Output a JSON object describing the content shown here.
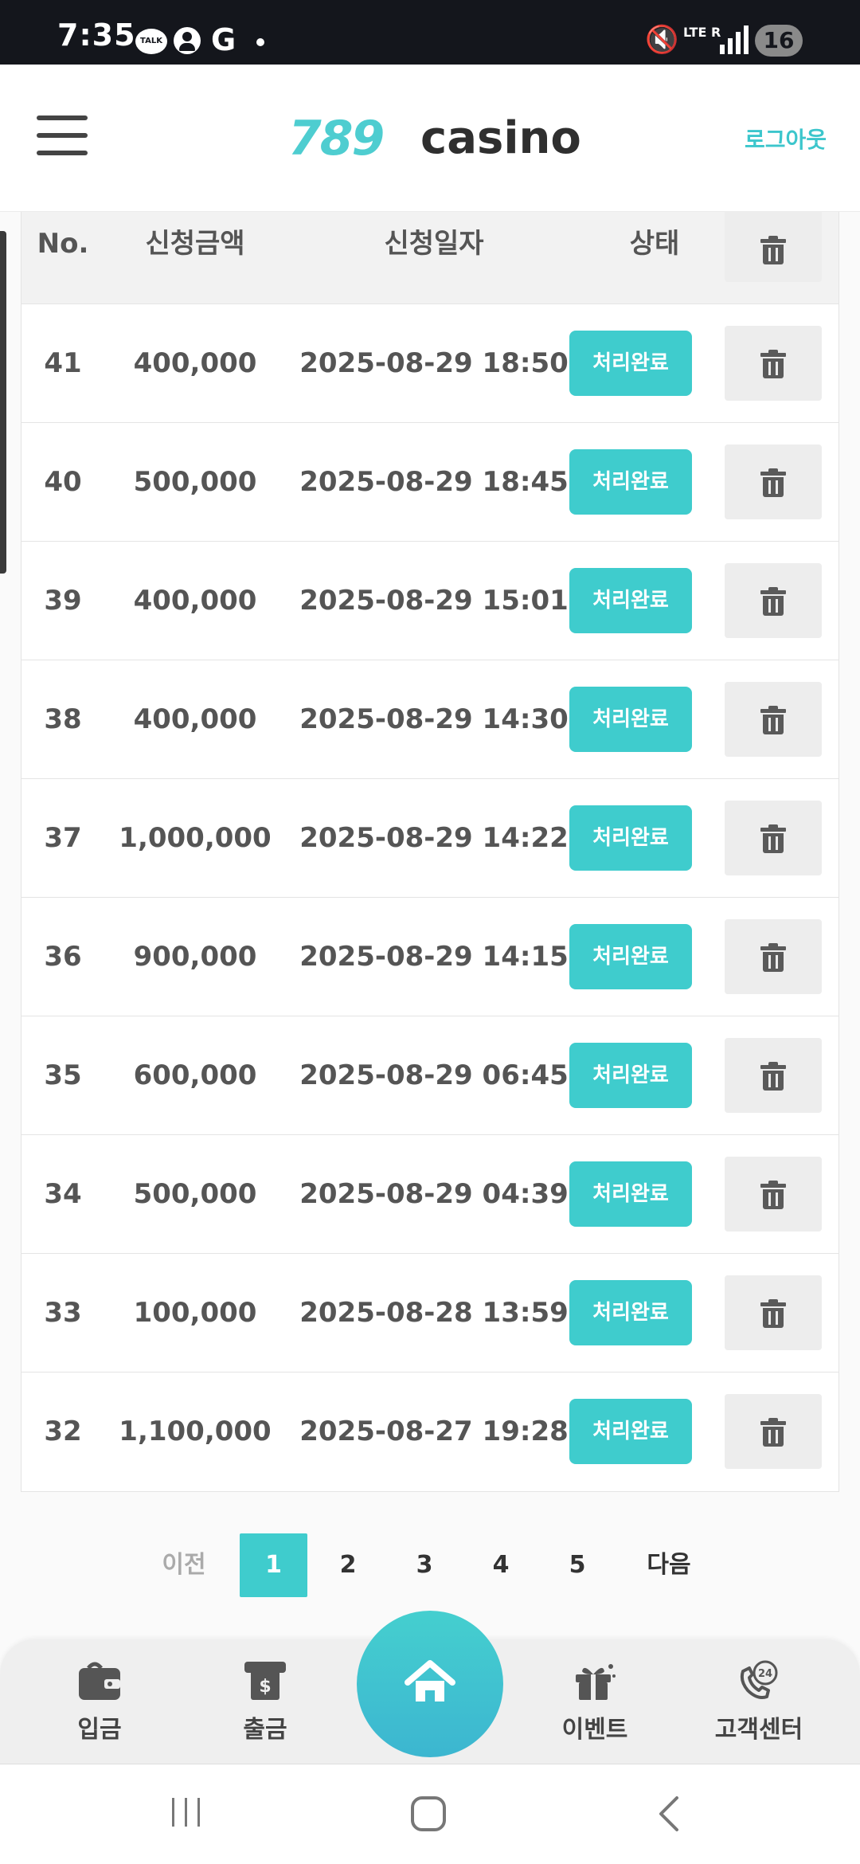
{
  "status_bar": {
    "time": "7:35",
    "talk_label": "TALK",
    "g_label": "G",
    "network_label": "LTE R",
    "battery": "16"
  },
  "header": {
    "logo_number": "789",
    "logo_word": "casino",
    "logout_label": "로그아웃"
  },
  "table": {
    "headers": [
      "No.",
      "신청금액",
      "신청일자",
      "상태"
    ],
    "rows": [
      {
        "no": "41",
        "amount": "400,000",
        "date": "2025-08-29 18:50",
        "status": "처리완료"
      },
      {
        "no": "40",
        "amount": "500,000",
        "date": "2025-08-29 18:45",
        "status": "처리완료"
      },
      {
        "no": "39",
        "amount": "400,000",
        "date": "2025-08-29 15:01",
        "status": "처리완료"
      },
      {
        "no": "38",
        "amount": "400,000",
        "date": "2025-08-29 14:30",
        "status": "처리완료"
      },
      {
        "no": "37",
        "amount": "1,000,000",
        "date": "2025-08-29 14:22",
        "status": "처리완료"
      },
      {
        "no": "36",
        "amount": "900,000",
        "date": "2025-08-29 14:15",
        "status": "처리완료"
      },
      {
        "no": "35",
        "amount": "600,000",
        "date": "2025-08-29 06:45",
        "status": "처리완료"
      },
      {
        "no": "34",
        "amount": "500,000",
        "date": "2025-08-29 04:39",
        "status": "처리완료"
      },
      {
        "no": "33",
        "amount": "100,000",
        "date": "2025-08-28 13:59",
        "status": "처리완료"
      },
      {
        "no": "32",
        "amount": "1,100,000",
        "date": "2025-08-27 19:28",
        "status": "처리완료"
      }
    ]
  },
  "pagination": {
    "prev_label": "이전",
    "pages": [
      "1",
      "2",
      "3",
      "4",
      "5"
    ],
    "active_page": "1",
    "next_label": "다음"
  },
  "bottom_nav": {
    "items": [
      {
        "label": "입금",
        "icon": "wallet-icon"
      },
      {
        "label": "출금",
        "icon": "cash-withdraw-icon"
      },
      {
        "label": "",
        "icon": "home-icon"
      },
      {
        "label": "이벤트",
        "icon": "gift-icon"
      },
      {
        "label": "고객센터",
        "icon": "support-24-icon"
      }
    ]
  },
  "colors": {
    "accent": "#3fcccd",
    "header_bg": "#f2f2f2",
    "text": "#555555"
  }
}
